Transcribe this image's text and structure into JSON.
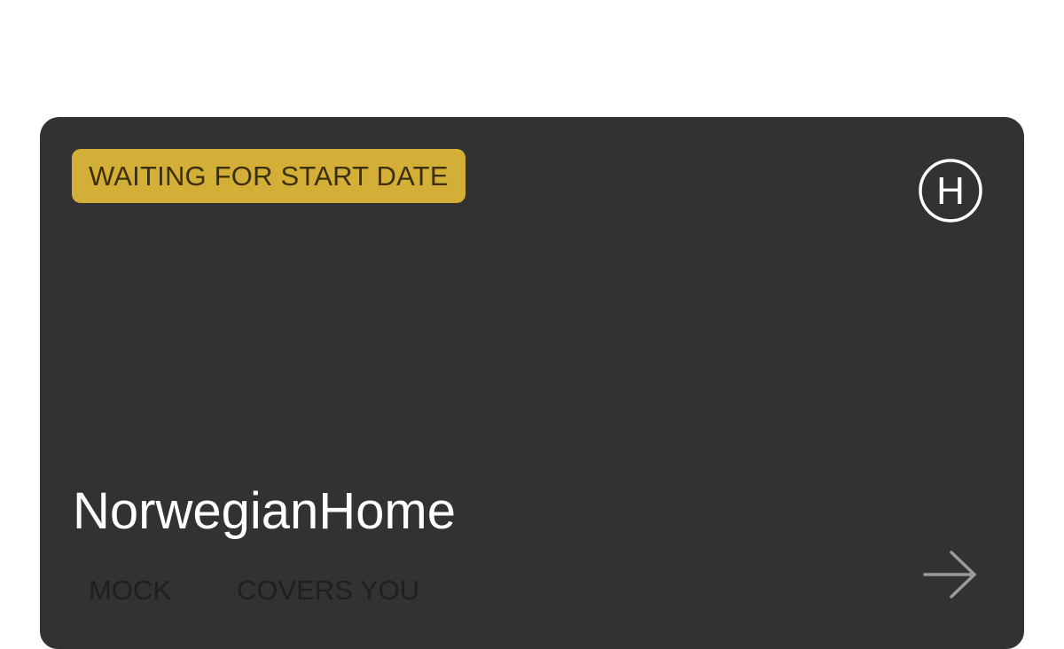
{
  "card": {
    "status": "WAITING FOR START DATE",
    "logo_letter": "H",
    "title": "NorwegianHome",
    "tags": [
      "MOCK",
      "COVERS YOU"
    ]
  },
  "colors": {
    "card_background": "#323232",
    "badge_background": "#d4af37",
    "badge_text": "#3a300e",
    "title_text": "#ffffff",
    "tag_text": "#1f1f1f",
    "arrow": "#9a9a9a"
  },
  "icons": {
    "logo": "circled-h-icon",
    "action": "arrow-right-icon"
  }
}
